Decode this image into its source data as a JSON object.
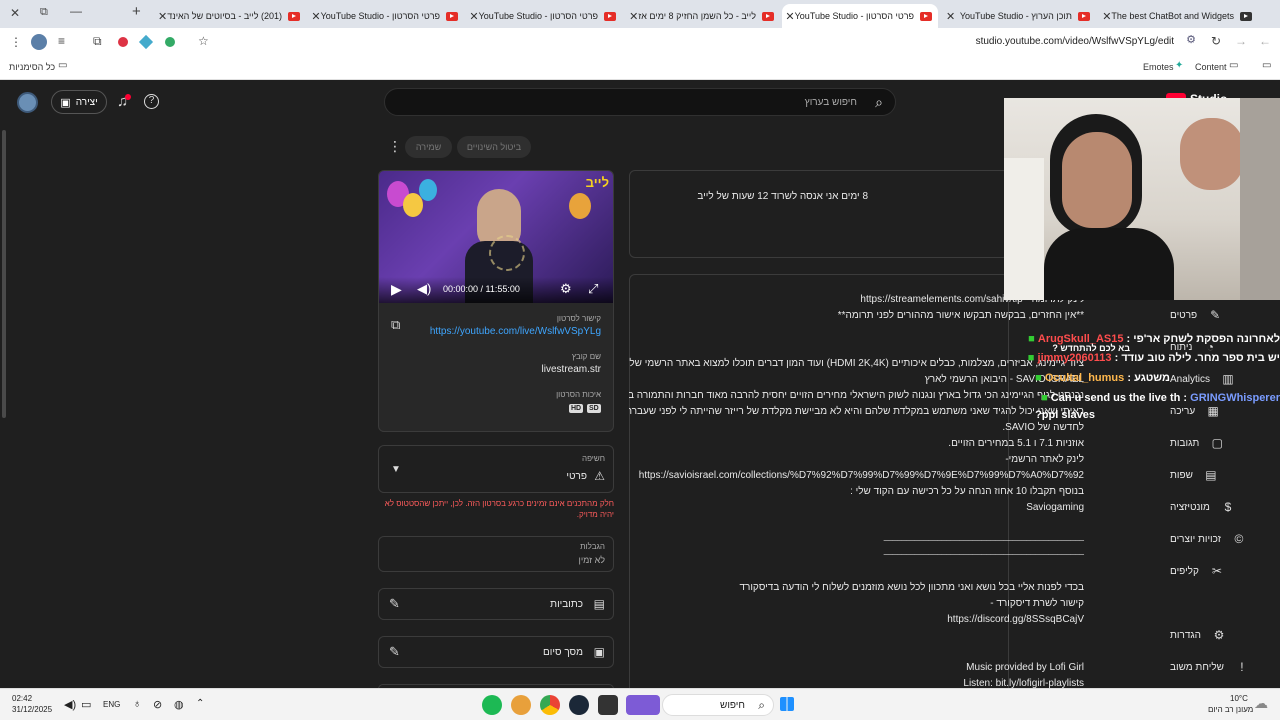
{
  "browser": {
    "tabs": [
      {
        "title": "The best ChatBot and Widgets"
      },
      {
        "title": "תוכן הערוץ - YouTube Studio"
      },
      {
        "title": "פרטי הסרטון - YouTube Studio"
      },
      {
        "title": "לייב - כל השמן החזיק 8 ימים אז"
      },
      {
        "title": "פרטי הסרטון - YouTube Studio"
      },
      {
        "title": "פרטי הסרטון - YouTube Studio"
      },
      {
        "title": "(201) לייב - בסיוטים של האינד"
      }
    ],
    "url": "studio.youtube.com/video/WslfwVSpYLg/edit",
    "bookmarks": {
      "left": "כל הסימניות",
      "emotes": "Emotes",
      "content": "Content"
    }
  },
  "header": {
    "search_placeholder": "חיפוש בערוץ",
    "create_label": "יצירה",
    "logo": "Studio"
  },
  "actions": {
    "undo": "ביטול השינויים",
    "save": "שמירה"
  },
  "title_box": {
    "value": "8 ימים אני אנסה לשרוד 12 שעות של לייב"
  },
  "description": {
    "lines": [
      "https://streamelements.com/sahiv/tip - לינק לתרומה",
      "**אין החזרים, בבקשה תבקשו אישור מההורים לפני תרומה**",
      "ציוד גיימינג, אביזרים, מצלמות, כבלים איכותיים (HDMI 2K,4K) ועוד המון דברים תוכלו למצוא באתר הרשמי של",
      "SAVIO ISRAEL - היבואן הרשמי לארץ",
      "נכנסנו לגוף הגיימינג הכי גדול בארץ ונגנוה לשוק הישראלי מחירים הזויים יחסית להרבה מאוד חברות והתמורה בכללי נוראה טובה.",
      "ראיתי שאני יכול להגיד שאני משתמש במקלדת שלהם והיא לא מביישת מקלדת של רייזר שהייתה לי לפני שעברתי",
      "לחדשה של SAVIO.",
      "אוזניות 7.1 ו 5.1 במחירים הזויים.",
      "לינק לאתר הרשמי-",
      "https://savioisrael.com/collections/%D7%92%D7%99%D7%99%D7%9E%D7%99%D7%A0%D7%92",
      "בנוסף תקבלו 10 אחוז הנחה על כל רכישה עם הקוד שלי :",
      "Saviogaming",
      "_____________________________________________",
      "_____________________________________________",
      "בכדי לפנות אליי בכל נושא ואני מתכוון לכל נושא מוזמנים לשלוח לי הודעה בדיסקורד",
      "קישור לשרת דיסקורד -",
      "https://discord.gg/8SSsqBCajV",
      "Music provided by Lofi Girl",
      "Listen: bit.ly/lofigirl-playlists"
    ]
  },
  "video_panel": {
    "time": "00:00:00 / 11:55:00",
    "thumb_text": "לייב",
    "link_label": "קישור לסרטון",
    "link_value": "https://youtube.com/live/WslfwVSpYLg",
    "file_label": "שם קובץ",
    "file_value": "livestream.str",
    "quality_label": "איכות הסרטון",
    "quality_badges": [
      "SD",
      "HD"
    ]
  },
  "visibility": {
    "label": "חשיפה",
    "value": "פרטי",
    "warning": "חלק מהתכנים אינם זמינים כרגע בסרטון הזה. לכן, ייתכן שהסטטוס לא יהיה מדויק."
  },
  "restrictions": {
    "label": "הגבלות",
    "value": "לא זמין"
  },
  "subtitles": {
    "label": "כתוביות"
  },
  "endscreen": {
    "label": "מסך סיום"
  },
  "sidebar": {
    "items": [
      {
        "label": "פרטים",
        "icon": "pencil-icon"
      },
      {
        "label": "ניתוח",
        "icon": "analytics-icon"
      },
      {
        "label": "Analytics",
        "icon": "chart-icon"
      },
      {
        "label": "עריכה",
        "icon": "editor-icon"
      },
      {
        "label": "תגובות",
        "icon": "comments-icon"
      },
      {
        "label": "שפות",
        "icon": "subtitles-icon"
      },
      {
        "label": "מונטיזציה",
        "icon": "dollar-icon"
      },
      {
        "label": "זכויות יוצרים",
        "icon": "copyright-icon"
      },
      {
        "label": "קליפים",
        "icon": "scissors-icon"
      },
      {
        "label": "הגדרות",
        "icon": "gear-icon"
      },
      {
        "label": "שליחת משוב",
        "icon": "feedback-icon"
      }
    ]
  },
  "chat": {
    "lines": [
      {
        "user": "ArugSkull_AS15",
        "text": "לאחרונה הפסקת לשחק אר'פי :",
        "color": "#ff4d4d"
      },
      {
        "user": "",
        "text": "בא לכם להתחדש ?",
        "color": "#ffffff"
      },
      {
        "user": "jimmy2060113",
        "text": "יש בית ספר מחר. לילה טוב עודד :",
        "color": "#ff4d4d"
      },
      {
        "user": "Ocultal_humus",
        "text": "משטגע :",
        "color": "#ffb84d"
      },
      {
        "user": "GRINGWhisperer",
        "text": "Can u send us the live th :",
        "color": "#7a9cff"
      },
      {
        "user": "",
        "text": "ppl slaves?",
        "color": "#ffffff"
      }
    ]
  },
  "taskbar": {
    "time": "02:42",
    "date": "31/12/2025",
    "lang": "ENG",
    "search": "חיפוש",
    "weather": "10°C",
    "weather_desc": "מעונן רב היום"
  }
}
